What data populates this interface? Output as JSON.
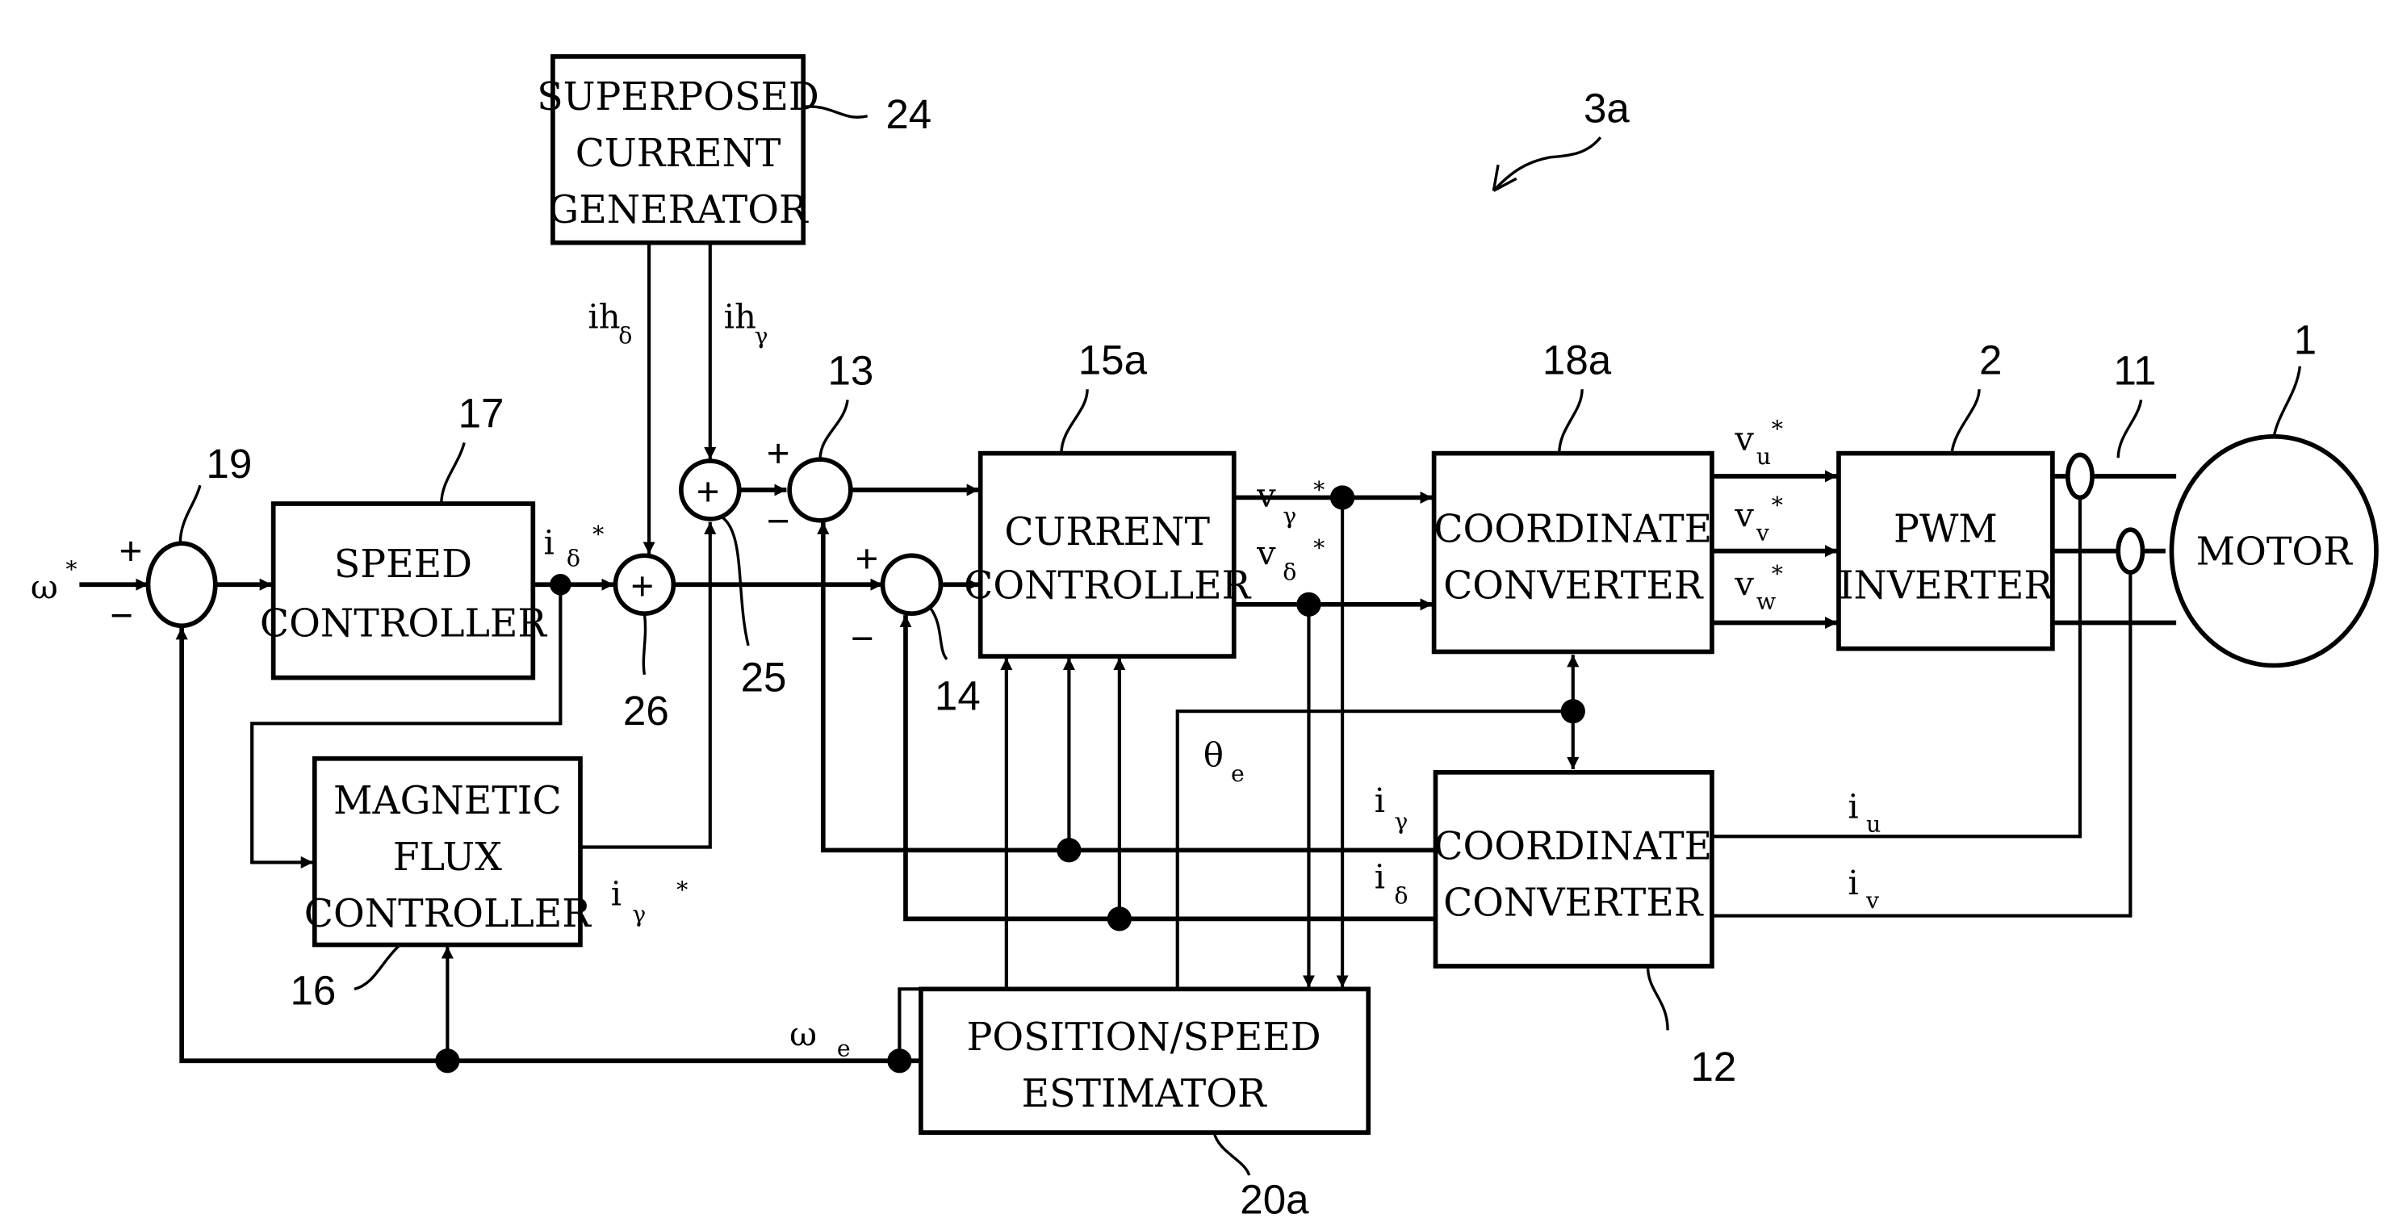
{
  "figure_label": "3a",
  "blocks": {
    "superposed_current_generator": {
      "ref": "24",
      "lines": [
        "SUPERPOSED",
        "CURRENT",
        "GENERATOR"
      ]
    },
    "speed_controller": {
      "ref": "17",
      "lines": [
        "SPEED",
        "CONTROLLER"
      ]
    },
    "magnetic_flux_controller": {
      "ref": "16",
      "lines": [
        "MAGNETIC",
        "FLUX",
        "CONTROLLER"
      ]
    },
    "current_controller": {
      "ref": "15a",
      "lines": [
        "CURRENT",
        "CONTROLLER"
      ]
    },
    "coordinate_converter_top": {
      "ref": "18a",
      "lines": [
        "COORDINATE",
        "CONVERTER"
      ]
    },
    "coordinate_converter_bottom": {
      "ref": "12",
      "lines": [
        "COORDINATE",
        "CONVERTER"
      ]
    },
    "pwm_inverter": {
      "ref": "2",
      "lines": [
        "PWM",
        "INVERTER"
      ]
    },
    "motor": {
      "ref": "1",
      "label": "MOTOR"
    },
    "position_speed_estimator": {
      "ref": "20a",
      "lines": [
        "POSITION/SPEED",
        "ESTIMATOR"
      ]
    }
  },
  "summing_points": {
    "s19": {
      "ref": "19",
      "plus": "+",
      "minus": "−"
    },
    "s26": {
      "ref": "26",
      "symbol": "+"
    },
    "s25": {
      "ref": "25",
      "symbol": "+"
    },
    "s13": {
      "ref": "13",
      "plus": "+",
      "minus": "−"
    },
    "s14": {
      "ref": "14",
      "plus": "+",
      "minus": "−"
    }
  },
  "current_sensor_ref": "11",
  "signals": {
    "omega_ref": {
      "main": "ω",
      "sup": "*"
    },
    "i_delta_ref": {
      "main": "i",
      "sub": "δ",
      "sup": "*"
    },
    "i_gamma_ref": {
      "main": "i",
      "sub": "γ",
      "sup": "*"
    },
    "ih_delta": {
      "main": "ih",
      "sub": "δ"
    },
    "ih_gamma": {
      "main": "ih",
      "sub": "γ"
    },
    "v_gamma_ref": {
      "main": "v",
      "sub": "γ",
      "sup": "*"
    },
    "v_delta_ref": {
      "main": "v",
      "sub": "δ",
      "sup": "*"
    },
    "vu_ref": {
      "main": "v",
      "sub": "u",
      "sup": "*"
    },
    "vv_ref": {
      "main": "v",
      "sub": "v",
      "sup": "*"
    },
    "vw_ref": {
      "main": "v",
      "sub": "w",
      "sup": "*"
    },
    "theta_e": {
      "main": "θ",
      "sub": "e"
    },
    "omega_e": {
      "main": "ω",
      "sub": "e"
    },
    "i_gamma": {
      "main": "i",
      "sub": "γ"
    },
    "i_delta": {
      "main": "i",
      "sub": "δ"
    },
    "i_u": {
      "main": "i",
      "sub": "u"
    },
    "i_v": {
      "main": "i",
      "sub": "v"
    }
  }
}
